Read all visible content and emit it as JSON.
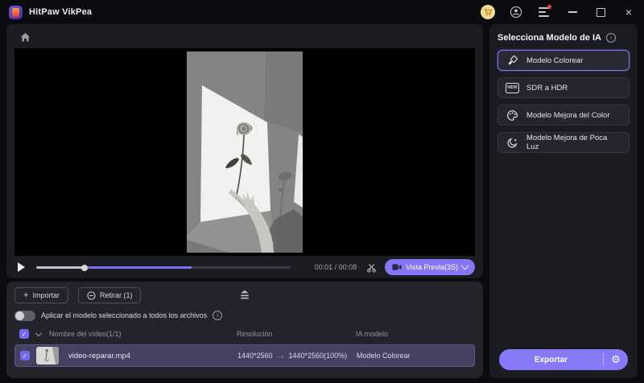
{
  "titlebar": {
    "app_title": "HitPaw VikPea"
  },
  "player": {
    "time": "00:01 / 00:08",
    "preview_button_label": "Vista Previa(3S)"
  },
  "files": {
    "import_label": "Importar",
    "remove_label": "Retirar (1)",
    "apply_all_label": "Aplicar el modelo seleccionado a todos los archivos",
    "columns": {
      "name": "Nombre del vídeo(1/1)",
      "resolution": "Resolución",
      "model": "IA modelo"
    },
    "header_checked": "✓",
    "rows": [
      {
        "checked": "✓",
        "name": "video-reparar.mp4",
        "resolution_from": "1440*2560",
        "arrow": "→",
        "resolution_to": "1440*2560(100%)",
        "model": "Modelo Colorear"
      }
    ]
  },
  "sidebar": {
    "title": "Selecciona Modelo de IA",
    "models": [
      {
        "label": "Modelo Colorear"
      },
      {
        "label": "SDR a HDR",
        "badge": "HDR"
      },
      {
        "label": "Modelo Mejora del Color"
      },
      {
        "label": "Modelo Mejora de Poca Luz"
      }
    ],
    "export_label": "Exportar"
  },
  "colors": {
    "accent": "#8577f6",
    "selected_row": "#454160",
    "selected_model_border": "#8273f0",
    "store_badge": "#f2dd8f",
    "notification_dot": "#e24b4b"
  }
}
